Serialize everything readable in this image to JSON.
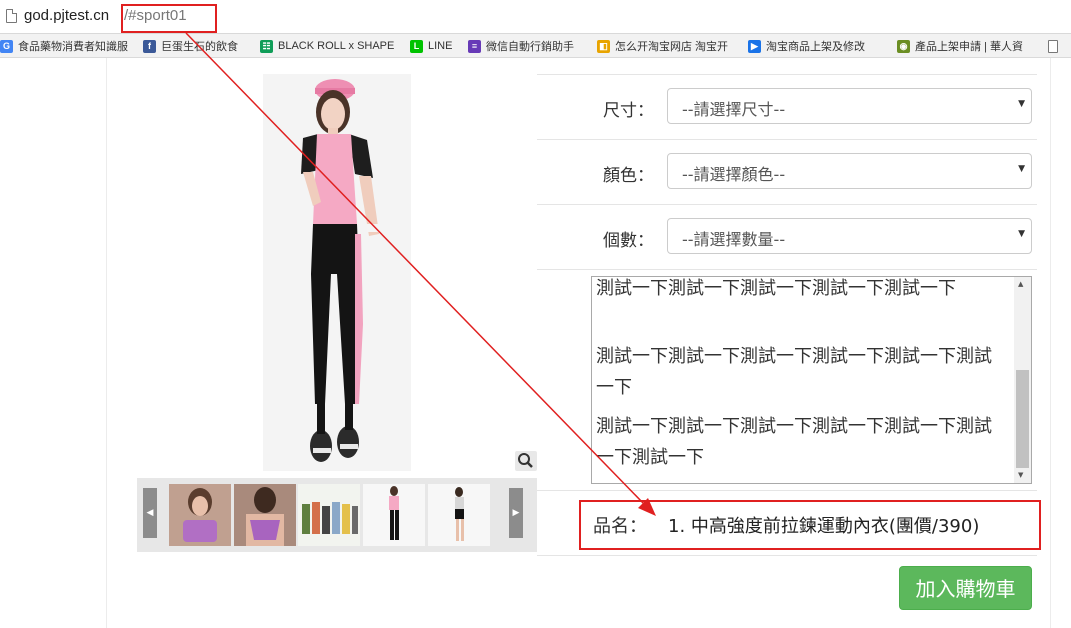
{
  "address_bar": {
    "domain": "god.pjtest.cn",
    "hash": "/#sport01"
  },
  "bookmarks": [
    {
      "label": "食品藥物消費者知識服",
      "icon": "google-icon",
      "color": "#4285f4",
      "glyph": "G"
    },
    {
      "label": "巨蛋生石的飲食",
      "icon": "facebook-icon",
      "color": "#3b5998",
      "glyph": "f"
    },
    {
      "label": "BLACK ROLL x SHAPE",
      "icon": "sheets-icon",
      "color": "#0f9d58",
      "glyph": "☷"
    },
    {
      "label": "LINE",
      "icon": "line-icon",
      "color": "#00c300",
      "glyph": "L"
    },
    {
      "label": "微信自動行銷助手",
      "icon": "forms-icon",
      "color": "#673ab7",
      "glyph": "≡"
    },
    {
      "label": "怎么开淘宝网店 淘宝开",
      "icon": "image-icon",
      "color": "#e8a400",
      "glyph": "◧"
    },
    {
      "label": "淘宝商品上架及修改",
      "icon": "video-icon",
      "color": "#1a73e8",
      "glyph": "▶"
    },
    {
      "label": "產品上架申請 | 華人資",
      "icon": "globe-icon",
      "color": "#6b8e23",
      "glyph": "◉"
    },
    {
      "label": "",
      "icon": "page-icon",
      "color": "#ffffff",
      "glyph": ""
    }
  ],
  "form": {
    "size_label": "尺寸：",
    "size_placeholder": "--請選擇尺寸--",
    "color_label": "顏色：",
    "color_placeholder": "--請選擇顏色--",
    "qty_label": "個數：",
    "qty_placeholder": "--請選擇數量--"
  },
  "description": [
    "測試一下測試一下測試一下測試一下測試一下",
    "測試一下測試一下測試一下測試一下測試一下測試一下",
    "測試一下測試一下測試一下測試一下測試一下測試一下測試一下"
  ],
  "product": {
    "name_label": "品名：",
    "name_value": "1. 中高強度前拉鍊運動內衣(團價/390)"
  },
  "cart_button": "加入購物車",
  "colors": {
    "highlight": "#e02020",
    "cart": "#5cb85c"
  }
}
